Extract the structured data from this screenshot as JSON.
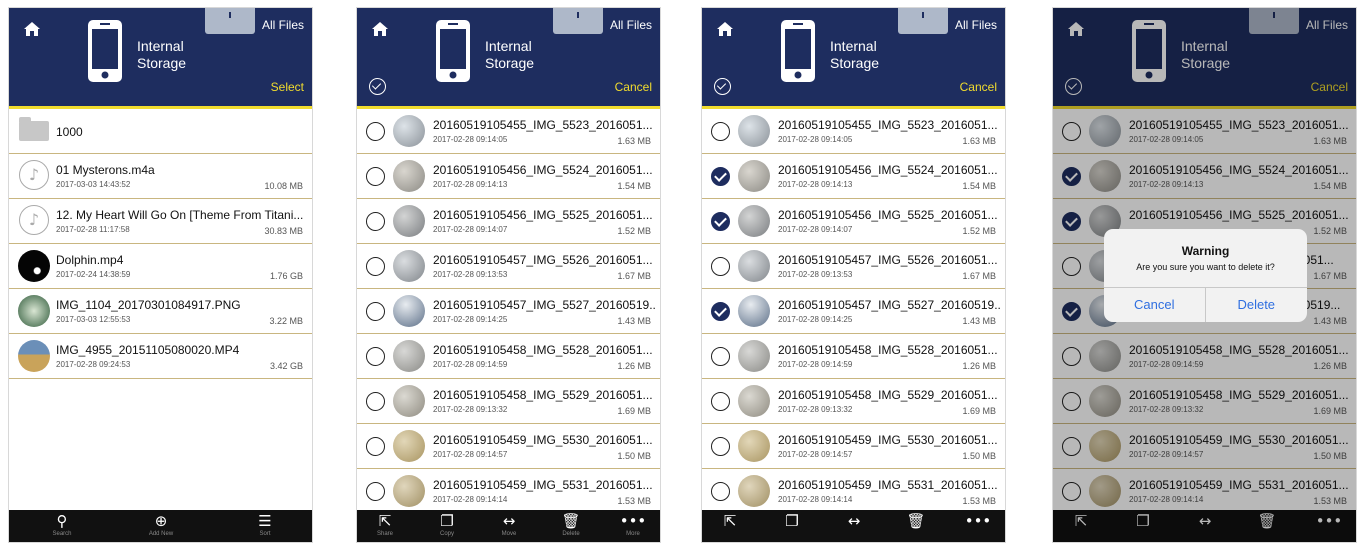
{
  "colors": {
    "header": "#1e2d5f",
    "accent": "#f1dc2e",
    "divider": "#c9b680",
    "check": "#1e2d5f",
    "dialog_button": "#2f6fe0"
  },
  "header": {
    "all_files": "All Files",
    "storage_line1": "Internal",
    "storage_line2": "Storage"
  },
  "screens": [
    {
      "mode": "browse",
      "action": "Select",
      "items": [
        {
          "kind": "folder",
          "icon": "folder-icon",
          "name": "1000"
        },
        {
          "kind": "audio",
          "icon": "music-note-icon",
          "name": "01 Mysterons.m4a",
          "date": "2017-03-03 14:43:52",
          "size": "10.08 MB"
        },
        {
          "kind": "audio",
          "icon": "music-note-icon",
          "name": "12. My Heart Will Go On [Theme From Titani...",
          "date": "2017-02-28 11:17:58",
          "size": "30.83 MB"
        },
        {
          "kind": "video",
          "icon": "dolphin-thumbnail",
          "name": "Dolphin.mp4",
          "date": "2017-02-24 14:38:59",
          "size": "1.76 GB"
        },
        {
          "kind": "image",
          "icon": "image-thumbnail",
          "name": "IMG_1104_20170301084917.PNG",
          "date": "2017-03-03 12:55:53",
          "size": "3.22 MB"
        },
        {
          "kind": "video",
          "icon": "landscape-thumbnail",
          "name": "IMG_4955_20151105080020.MP4",
          "date": "2017-02-28 09:24:53",
          "size": "3.42 GB"
        }
      ],
      "toolbar": [
        {
          "icon": "search-icon",
          "label": "Search"
        },
        {
          "icon": "add-icon",
          "label": "Add New"
        },
        {
          "icon": "sort-icon",
          "label": "Sort"
        }
      ]
    },
    {
      "mode": "select",
      "action": "Cancel",
      "items": [
        {
          "name": "20160519105455_IMG_5523_2016051...",
          "date": "2017-02-28 09:14:05",
          "size": "1.63 MB",
          "checked": false
        },
        {
          "name": "20160519105456_IMG_5524_2016051...",
          "date": "2017-02-28 09:14:13",
          "size": "1.54 MB",
          "checked": false
        },
        {
          "name": "20160519105456_IMG_5525_2016051...",
          "date": "2017-02-28 09:14:07",
          "size": "1.52 MB",
          "checked": false
        },
        {
          "name": "20160519105457_IMG_5526_2016051...",
          "date": "2017-02-28 09:13:53",
          "size": "1.67 MB",
          "checked": false
        },
        {
          "name": "20160519105457_IMG_5527_20160519...",
          "date": "2017-02-28 09:14:25",
          "size": "1.43 MB",
          "checked": false
        },
        {
          "name": "20160519105458_IMG_5528_2016051...",
          "date": "2017-02-28 09:14:59",
          "size": "1.26 MB",
          "checked": false
        },
        {
          "name": "20160519105458_IMG_5529_2016051...",
          "date": "2017-02-28 09:13:32",
          "size": "1.69 MB",
          "checked": false
        },
        {
          "name": "20160519105459_IMG_5530_2016051...",
          "date": "2017-02-28 09:14:57",
          "size": "1.50 MB",
          "checked": false
        },
        {
          "name": "20160519105459_IMG_5531_2016051...",
          "date": "2017-02-28 09:14:14",
          "size": "1.53 MB",
          "checked": false
        }
      ],
      "toolbar": [
        {
          "icon": "share-icon",
          "label": "Share"
        },
        {
          "icon": "copy-icon",
          "label": "Copy"
        },
        {
          "icon": "move-icon",
          "label": "Move"
        },
        {
          "icon": "trash-icon",
          "label": "Delete"
        },
        {
          "icon": "more-icon",
          "label": "More"
        }
      ]
    },
    {
      "mode": "select",
      "action": "Cancel",
      "items": [
        {
          "name": "20160519105455_IMG_5523_2016051...",
          "date": "2017-02-28 09:14:05",
          "size": "1.63 MB",
          "checked": false
        },
        {
          "name": "20160519105456_IMG_5524_2016051...",
          "date": "2017-02-28 09:14:13",
          "size": "1.54 MB",
          "checked": true
        },
        {
          "name": "20160519105456_IMG_5525_2016051...",
          "date": "2017-02-28 09:14:07",
          "size": "1.52 MB",
          "checked": true
        },
        {
          "name": "20160519105457_IMG_5526_2016051...",
          "date": "2017-02-28 09:13:53",
          "size": "1.67 MB",
          "checked": false
        },
        {
          "name": "20160519105457_IMG_5527_20160519...",
          "date": "2017-02-28 09:14:25",
          "size": "1.43 MB",
          "checked": true
        },
        {
          "name": "20160519105458_IMG_5528_2016051...",
          "date": "2017-02-28 09:14:59",
          "size": "1.26 MB",
          "checked": false
        },
        {
          "name": "20160519105458_IMG_5529_2016051...",
          "date": "2017-02-28 09:13:32",
          "size": "1.69 MB",
          "checked": false
        },
        {
          "name": "20160519105459_IMG_5530_2016051...",
          "date": "2017-02-28 09:14:57",
          "size": "1.50 MB",
          "checked": false
        },
        {
          "name": "20160519105459_IMG_5531_2016051...",
          "date": "2017-02-28 09:14:14",
          "size": "1.53 MB",
          "checked": false
        }
      ],
      "toolbar": [
        {
          "icon": "share-icon",
          "label": ""
        },
        {
          "icon": "copy-icon",
          "label": ""
        },
        {
          "icon": "move-icon",
          "label": ""
        },
        {
          "icon": "trash-icon",
          "label": ""
        },
        {
          "icon": "more-icon",
          "label": ""
        }
      ]
    },
    {
      "mode": "select",
      "action": "Cancel",
      "items": [
        {
          "name": "20160519105455_IMG_5523_2016051...",
          "date": "2017-02-28 09:14:05",
          "size": "1.63 MB",
          "checked": false
        },
        {
          "name": "20160519105456_IMG_5524_2016051...",
          "date": "2017-02-28 09:14:13",
          "size": "1.54 MB",
          "checked": true
        },
        {
          "name": "20160519105456_IMG_5525_2016051...",
          "date": "",
          "size": "1.52 MB",
          "checked": true
        },
        {
          "name": "6051...",
          "date": "",
          "size": "1.67 MB",
          "checked": false
        },
        {
          "name": "60519...",
          "date": "",
          "size": "1.43 MB",
          "checked": true
        },
        {
          "name": "20160519105458_IMG_5528_2016051...",
          "date": "2017-02-28 09:14:59",
          "size": "1.26 MB",
          "checked": false
        },
        {
          "name": "20160519105458_IMG_5529_2016051...",
          "date": "2017-02-28 09:13:32",
          "size": "1.69 MB",
          "checked": false
        },
        {
          "name": "20160519105459_IMG_5530_2016051...",
          "date": "2017-02-28 09:14:57",
          "size": "1.50 MB",
          "checked": false
        },
        {
          "name": "20160519105459_IMG_5531_2016051...",
          "date": "2017-02-28 09:14:14",
          "size": "1.53 MB",
          "checked": false
        }
      ],
      "toolbar": [
        {
          "icon": "share-icon",
          "label": ""
        },
        {
          "icon": "copy-icon",
          "label": ""
        },
        {
          "icon": "move-icon",
          "label": ""
        },
        {
          "icon": "trash-icon",
          "label": ""
        },
        {
          "icon": "more-icon",
          "label": ""
        }
      ],
      "dialog": {
        "title": "Warning",
        "message": "Are you sure you want to delete it?",
        "cancel": "Cancel",
        "confirm": "Delete"
      }
    }
  ]
}
